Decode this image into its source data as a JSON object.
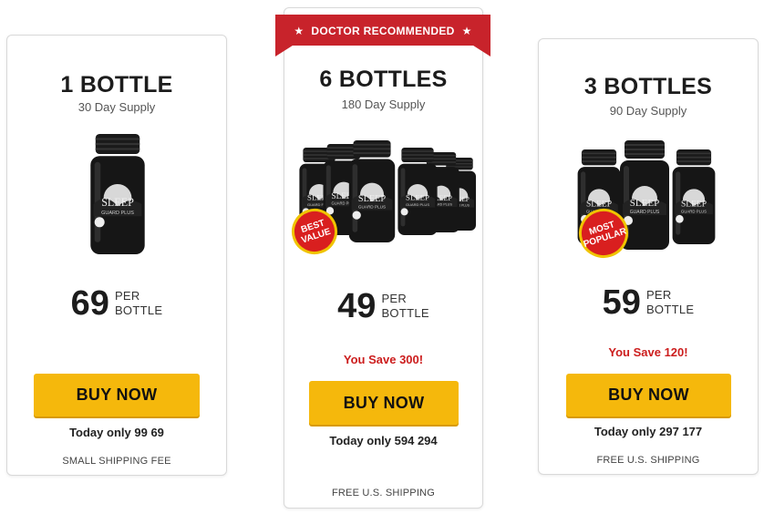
{
  "ribbon": {
    "label": "DOCTOR RECOMMENDED",
    "star": "★"
  },
  "product": {
    "brand_label": "SLEEP",
    "brand_sub": "GUARD PLUS",
    "capsule_count": "60"
  },
  "cards": [
    {
      "title": "1 BOTTLE",
      "supply": "30 Day Supply",
      "price": "69",
      "per_1": "PER",
      "per_2": "BOTTLE",
      "buy_label": "BUY NOW",
      "today_prefix": "Today only",
      "today_old": "99",
      "today_new": "69",
      "shipping": "SMALL SHIPPING FEE"
    },
    {
      "title": "6 BOTTLES",
      "supply": "180 Day Supply",
      "badge_1": "BEST",
      "badge_2": "VALUE",
      "price": "49",
      "per_1": "PER",
      "per_2": "BOTTLE",
      "save": "You Save 300!",
      "buy_label": "BUY NOW",
      "today_prefix": "Today only",
      "today_old": "594",
      "today_new": "294",
      "shipping": "FREE U.S. SHIPPING"
    },
    {
      "title": "3 BOTTLES",
      "supply": "90 Day Supply",
      "badge_1": "MOST",
      "badge_2": "POPULAR",
      "price": "59",
      "per_1": "PER",
      "per_2": "BOTTLE",
      "save": "You Save 120!",
      "buy_label": "BUY NOW",
      "today_prefix": "Today only",
      "today_old": "297",
      "today_new": "177",
      "shipping": "FREE U.S. SHIPPING"
    }
  ],
  "colors": {
    "accent_button": "#f5b80c",
    "ribbon": "#c8232b",
    "save_text": "#cc1d1d",
    "badge": "#d91f1f"
  }
}
